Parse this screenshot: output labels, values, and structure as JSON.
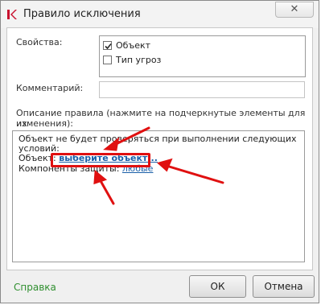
{
  "window": {
    "title": "Правило исключения",
    "close_label": "✕"
  },
  "properties": {
    "label": "Свойства:",
    "items": [
      {
        "label": "Объект",
        "checked": true
      },
      {
        "label": "Тип угроз",
        "checked": false
      }
    ]
  },
  "comment": {
    "label": "Комментарий:",
    "value": ""
  },
  "description": {
    "label_line1": "Описание правила (нажмите на подчеркнутые элементы для их",
    "label_line2": "изменения):",
    "line1": "Объект не будет проверяться при выполнении следующих",
    "line2": "условий:",
    "object_prefix": "Объект:",
    "object_link": "выберите объект...",
    "components_prefix": "Компоненты защиты:",
    "components_link": "любые"
  },
  "footer": {
    "help_label": "Справка",
    "ok_label": "ОК",
    "cancel_label": "Отмена"
  },
  "colors": {
    "link": "#1a5fa8",
    "highlight": "#e01010",
    "help": "#2f8f2f"
  }
}
